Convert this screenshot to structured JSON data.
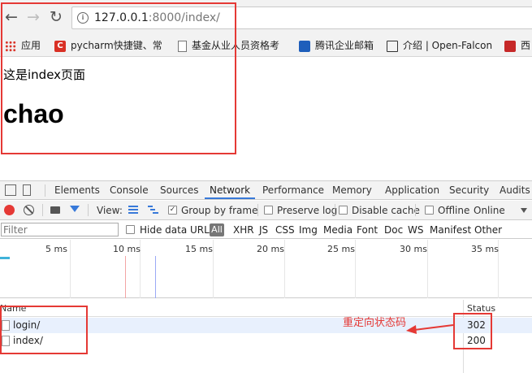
{
  "browser": {
    "back_icon": "arrow-left-icon",
    "forward_icon": "arrow-right-icon",
    "reload_icon": "reload-icon",
    "url_host": "127.0.0.1",
    "url_rest": ":8000/index/"
  },
  "bookmarks": [
    {
      "icon": "apps-grid-icon",
      "label": "应用"
    },
    {
      "icon": "c-logo-icon",
      "label": "pycharm快捷键、常"
    },
    {
      "icon": "document-icon",
      "label": "基金从业人员资格考"
    },
    {
      "icon": "mail-icon",
      "label": "腾讯企业邮箱"
    },
    {
      "icon": "book-icon",
      "label": "介绍 | Open-Falcon"
    },
    {
      "icon": "m-logo-icon",
      "label": "西"
    }
  ],
  "page": {
    "text": "这是index页面",
    "heading": "chao"
  },
  "devtools": {
    "tabs": [
      "Elements",
      "Console",
      "Sources",
      "Network",
      "Performance",
      "Memory",
      "Application",
      "Security",
      "Audits"
    ],
    "active_tab": "Network",
    "toolbar": {
      "view_label": "View:",
      "group_by_frame": {
        "label": "Group by frame",
        "checked": true
      },
      "preserve_log": {
        "label": "Preserve log",
        "checked": false
      },
      "disable_cache": {
        "label": "Disable cache",
        "checked": false
      },
      "offline": {
        "label": "Offline",
        "checked": false
      },
      "throttle": "Online"
    },
    "filterbar": {
      "placeholder": "Filter",
      "hide_data_urls": {
        "label": "Hide data URLs",
        "checked": false
      },
      "types": [
        "All",
        "XHR",
        "JS",
        "CSS",
        "Img",
        "Media",
        "Font",
        "Doc",
        "WS",
        "Manifest",
        "Other"
      ],
      "active_type": "All"
    },
    "timeline_ticks": [
      "5 ms",
      "10 ms",
      "15 ms",
      "20 ms",
      "25 ms",
      "30 ms",
      "35 ms"
    ],
    "columns": {
      "name": "Name",
      "status": "Status"
    },
    "requests": [
      {
        "name": "login/",
        "status": "302",
        "selected": true
      },
      {
        "name": "index/",
        "status": "200",
        "selected": false
      }
    ]
  },
  "annotation": {
    "text": "重定向状态码",
    "color": "#e53935"
  }
}
